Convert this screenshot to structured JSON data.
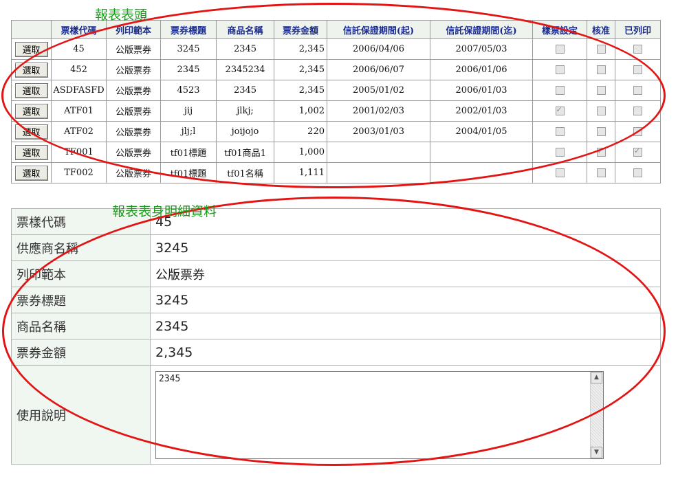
{
  "annotations": {
    "header_title": "報表表頭",
    "detail_title": "報表表身明細資料"
  },
  "grid": {
    "columns": [
      "",
      "票樣代碼",
      "列印範本",
      "票券標題",
      "商品名稱",
      "票券金額",
      "信託保證期間(起)",
      "信託保證期間(迄)",
      "樣票設定",
      "核准",
      "已列印"
    ],
    "select_label": "選取",
    "rows": [
      {
        "code": "45",
        "template": "公版票券",
        "title": "3245",
        "product": "2345",
        "amount": "2,345",
        "start": "2006/04/06",
        "end": "2007/05/03",
        "sample": false,
        "approved": false,
        "printed": false
      },
      {
        "code": "452",
        "template": "公版票券",
        "title": "2345",
        "product": "2345234",
        "amount": "2,345",
        "start": "2006/06/07",
        "end": "2006/01/06",
        "sample": false,
        "approved": false,
        "printed": false
      },
      {
        "code": "ASDFASFD",
        "template": "公版票券",
        "title": "4523",
        "product": "2345",
        "amount": "2,345",
        "start": "2005/01/02",
        "end": "2006/01/03",
        "sample": false,
        "approved": false,
        "printed": false
      },
      {
        "code": "ATF01",
        "template": "公版票券",
        "title": "jij",
        "product": "jlkj;",
        "amount": "1,002",
        "start": "2001/02/03",
        "end": "2002/01/03",
        "sample": true,
        "approved": false,
        "printed": false
      },
      {
        "code": "ATF02",
        "template": "公版票券",
        "title": "jlj;l",
        "product": "joijojo",
        "amount": "220",
        "start": "2003/01/03",
        "end": "2004/01/05",
        "sample": false,
        "approved": false,
        "printed": false
      },
      {
        "code": "TF001",
        "template": "公版票券",
        "title": "tf01標題",
        "product": "tf01商品1",
        "amount": "1,000",
        "start": "",
        "end": "",
        "sample": false,
        "approved": true,
        "printed": true
      },
      {
        "code": "TF002",
        "template": "公版票券",
        "title": "tf01標題",
        "product": "tf01名稱",
        "amount": "1,111",
        "start": "",
        "end": "",
        "sample": false,
        "approved": false,
        "printed": false
      }
    ]
  },
  "detail": {
    "fields": [
      {
        "label": "票樣代碼",
        "value": "45"
      },
      {
        "label": "供應商名稱",
        "value": "3245"
      },
      {
        "label": "列印範本",
        "value": "公版票券"
      },
      {
        "label": "票券標題",
        "value": "3245"
      },
      {
        "label": "商品名稱",
        "value": "2345"
      },
      {
        "label": "票券金額",
        "value": "2,345"
      }
    ],
    "usage_label": "使用說明",
    "usage_value": "2345"
  },
  "colors": {
    "annotation": "#1c9b1c",
    "highlight_oval": "#e31414",
    "header_text": "#1a2a8a"
  }
}
